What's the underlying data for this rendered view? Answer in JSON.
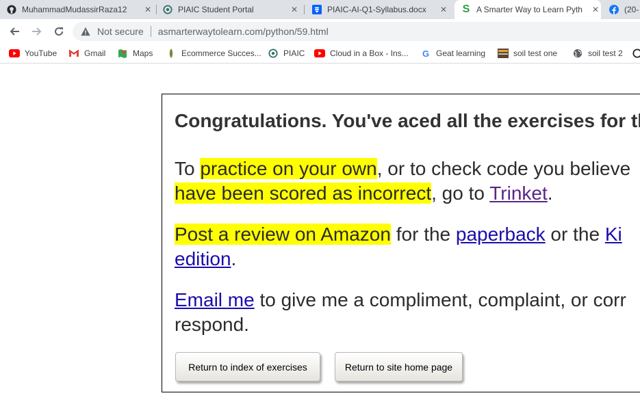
{
  "tabs": [
    {
      "title": "MuhammadMudassirRaza12",
      "icon": "github-icon"
    },
    {
      "title": "PIAIC Student Portal",
      "icon": "piaic-icon"
    },
    {
      "title": "PIAIC-AI-Q1-Syllabus.docx",
      "icon": "dropbox-icon"
    },
    {
      "title": "A Smarter Way to Learn Pyth",
      "icon": "smarter-way-icon"
    },
    {
      "title": "(20-",
      "icon": "facebook-icon"
    }
  ],
  "omnibox": {
    "security": "Not secure",
    "url": "asmarterwaytolearn.com/python/59.html"
  },
  "bookmarks": [
    {
      "label": "YouTube",
      "icon": "youtube-icon"
    },
    {
      "label": "Gmail",
      "icon": "gmail-icon"
    },
    {
      "label": "Maps",
      "icon": "maps-icon"
    },
    {
      "label": "Ecommerce Succes...",
      "icon": "ecommerce-icon"
    },
    {
      "label": "PIAIC",
      "icon": "piaic-icon"
    },
    {
      "label": "Cloud in a Box - Ins...",
      "icon": "youtube-icon"
    },
    {
      "label": "Geat learning",
      "icon": "google-icon"
    },
    {
      "label": "soil test one",
      "icon": "soil-test-icon"
    },
    {
      "label": "soil test 2",
      "icon": "globe-icon"
    }
  ],
  "page": {
    "heading": "Congratulations. You've aced all the exercises for th",
    "p1": {
      "a": "To ",
      "h1": "practice on your own",
      "b": ", or to check code you believe",
      "h2": "have been scored as incorrect",
      "c": ", go to ",
      "link": "Trinket",
      "d": "."
    },
    "p2": {
      "h1": "Post a review on Amazon",
      "a": " for the ",
      "link1": "paperback",
      "b": " or the ",
      "link2a": "Ki",
      "link2b": "edition",
      "c": "."
    },
    "p3": {
      "link": "Email me",
      "a": " to give me a compliment, complaint, or corr",
      "b": "respond."
    },
    "buttons": {
      "index": "Return to index of exercises",
      "home": "Return to site home page"
    }
  },
  "colors": {
    "highlight": "#ffff00",
    "link": "#1a0dab",
    "visited_link": "#58268a"
  }
}
